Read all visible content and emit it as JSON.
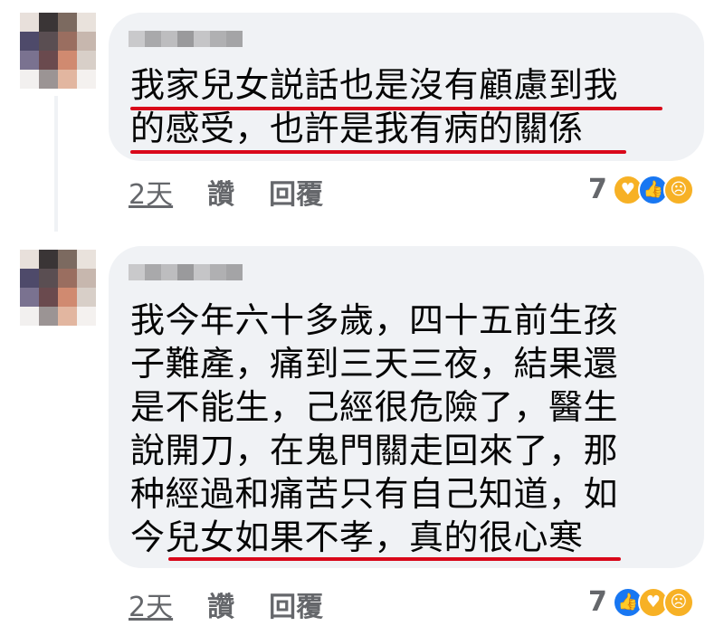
{
  "comments": [
    {
      "text": "我家兒女説話也是沒有顧慮到我\n的感受，也許是我有病的關係",
      "time": "2天",
      "like_label": "讚",
      "reply_label": "回覆",
      "reaction_count": "7",
      "reactions": [
        "care-icon",
        "like-icon",
        "sad-icon"
      ]
    },
    {
      "text": "我今年六十多歲，四十五前生孩\n子難產，痛到三天三夜，結果還\n是不能生，己經很危險了，醫生\n說開刀，在鬼門關走回來了，那\n种經過和痛苦只有自己知道，如\n今兒女如果不孝，真的很心寒",
      "time": "2天",
      "like_label": "讚",
      "reply_label": "回覆",
      "reaction_count": "7",
      "reactions": [
        "like-icon",
        "care-icon",
        "sad-icon"
      ]
    }
  ],
  "colors": {
    "bubble_bg": "#f0f2f5",
    "underline": "#d9081a",
    "meta_text": "#65676b",
    "like_blue": "#1877f2",
    "emoji_yellow": "#f7b125"
  }
}
